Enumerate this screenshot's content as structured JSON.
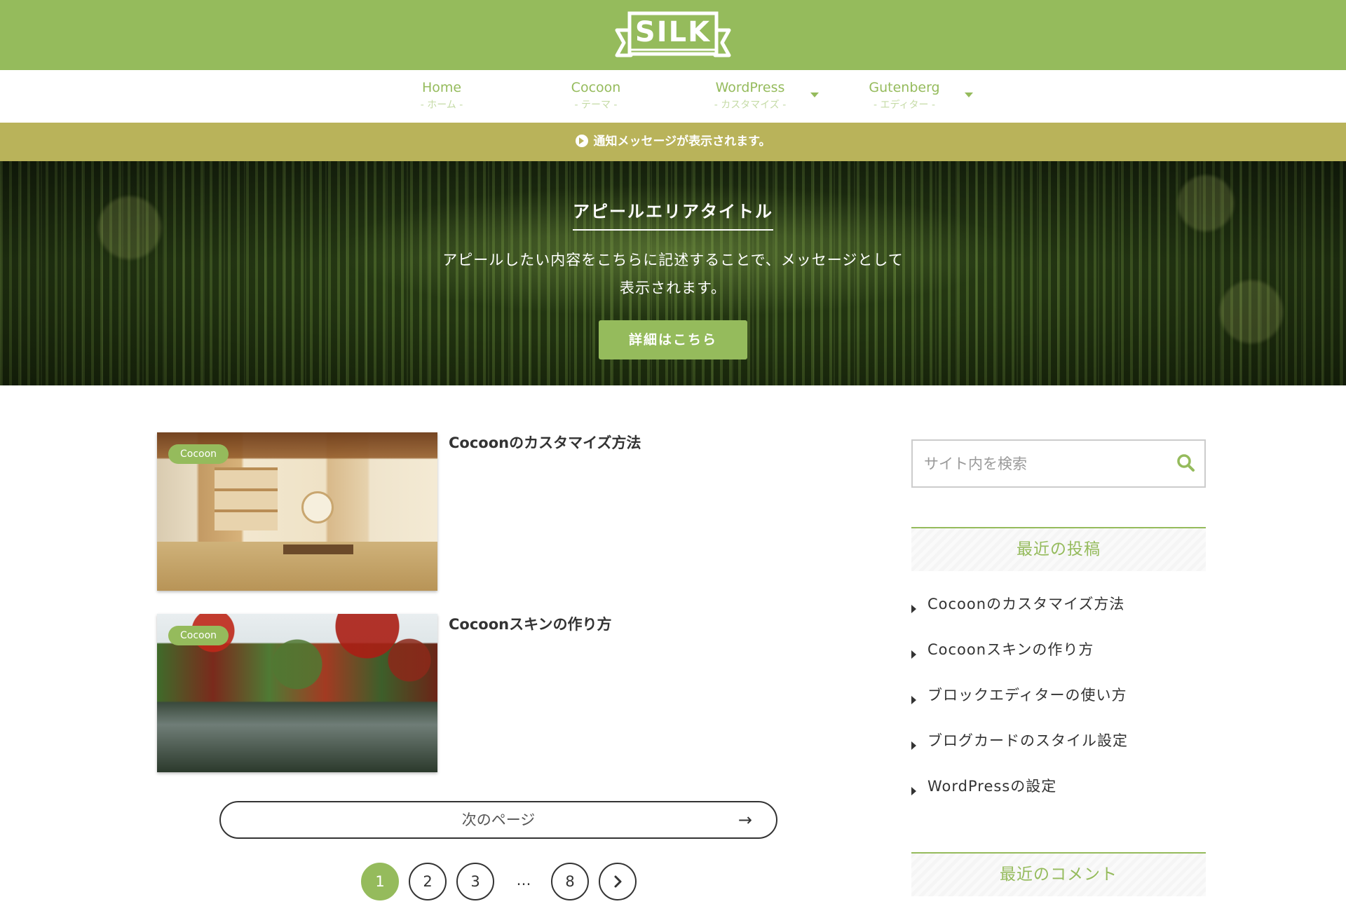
{
  "header": {
    "logo_text": "SILK"
  },
  "nav": {
    "items": [
      {
        "label": "Home",
        "sub": "- ホーム -",
        "has_dropdown": false
      },
      {
        "label": "Cocoon",
        "sub": "- テーマ -",
        "has_dropdown": false
      },
      {
        "label": "WordPress",
        "sub": "- カスタマイズ -",
        "has_dropdown": true
      },
      {
        "label": "Gutenberg",
        "sub": "- エディター -",
        "has_dropdown": true
      }
    ]
  },
  "notice": {
    "text": "通知メッセージが表示されます。",
    "icon": "arrow-circle-right-icon"
  },
  "appeal": {
    "title": "アピールエリアタイトル",
    "message": "アピールしたい内容をこちらに記述することで、メッセージとして表示されます。",
    "button_label": "詳細はこちら"
  },
  "posts": [
    {
      "category": "Cocoon",
      "title": "Cocoonのカスタマイズ方法"
    },
    {
      "category": "Cocoon",
      "title": "Cocoonスキンの作り方"
    }
  ],
  "pager": {
    "next_label": "次のページ",
    "next_arrow": "→",
    "pages": [
      "1",
      "2",
      "3",
      "8"
    ],
    "current": "1",
    "dots": "…",
    "next_icon": "chevron-right-icon"
  },
  "sidebar": {
    "search_placeholder": "サイト内を検索",
    "recent_posts_title": "最近の投稿",
    "recent_posts": [
      "Cocoonのカスタマイズ方法",
      "Cocoonスキンの作り方",
      "ブロックエディターの使い方",
      "ブログカードのスタイル設定",
      "WordPressの設定"
    ],
    "recent_comments_title": "最近のコメント"
  },
  "colors": {
    "accent": "#95bb5c",
    "notice_bg": "#b9b35a",
    "text": "#333333"
  }
}
